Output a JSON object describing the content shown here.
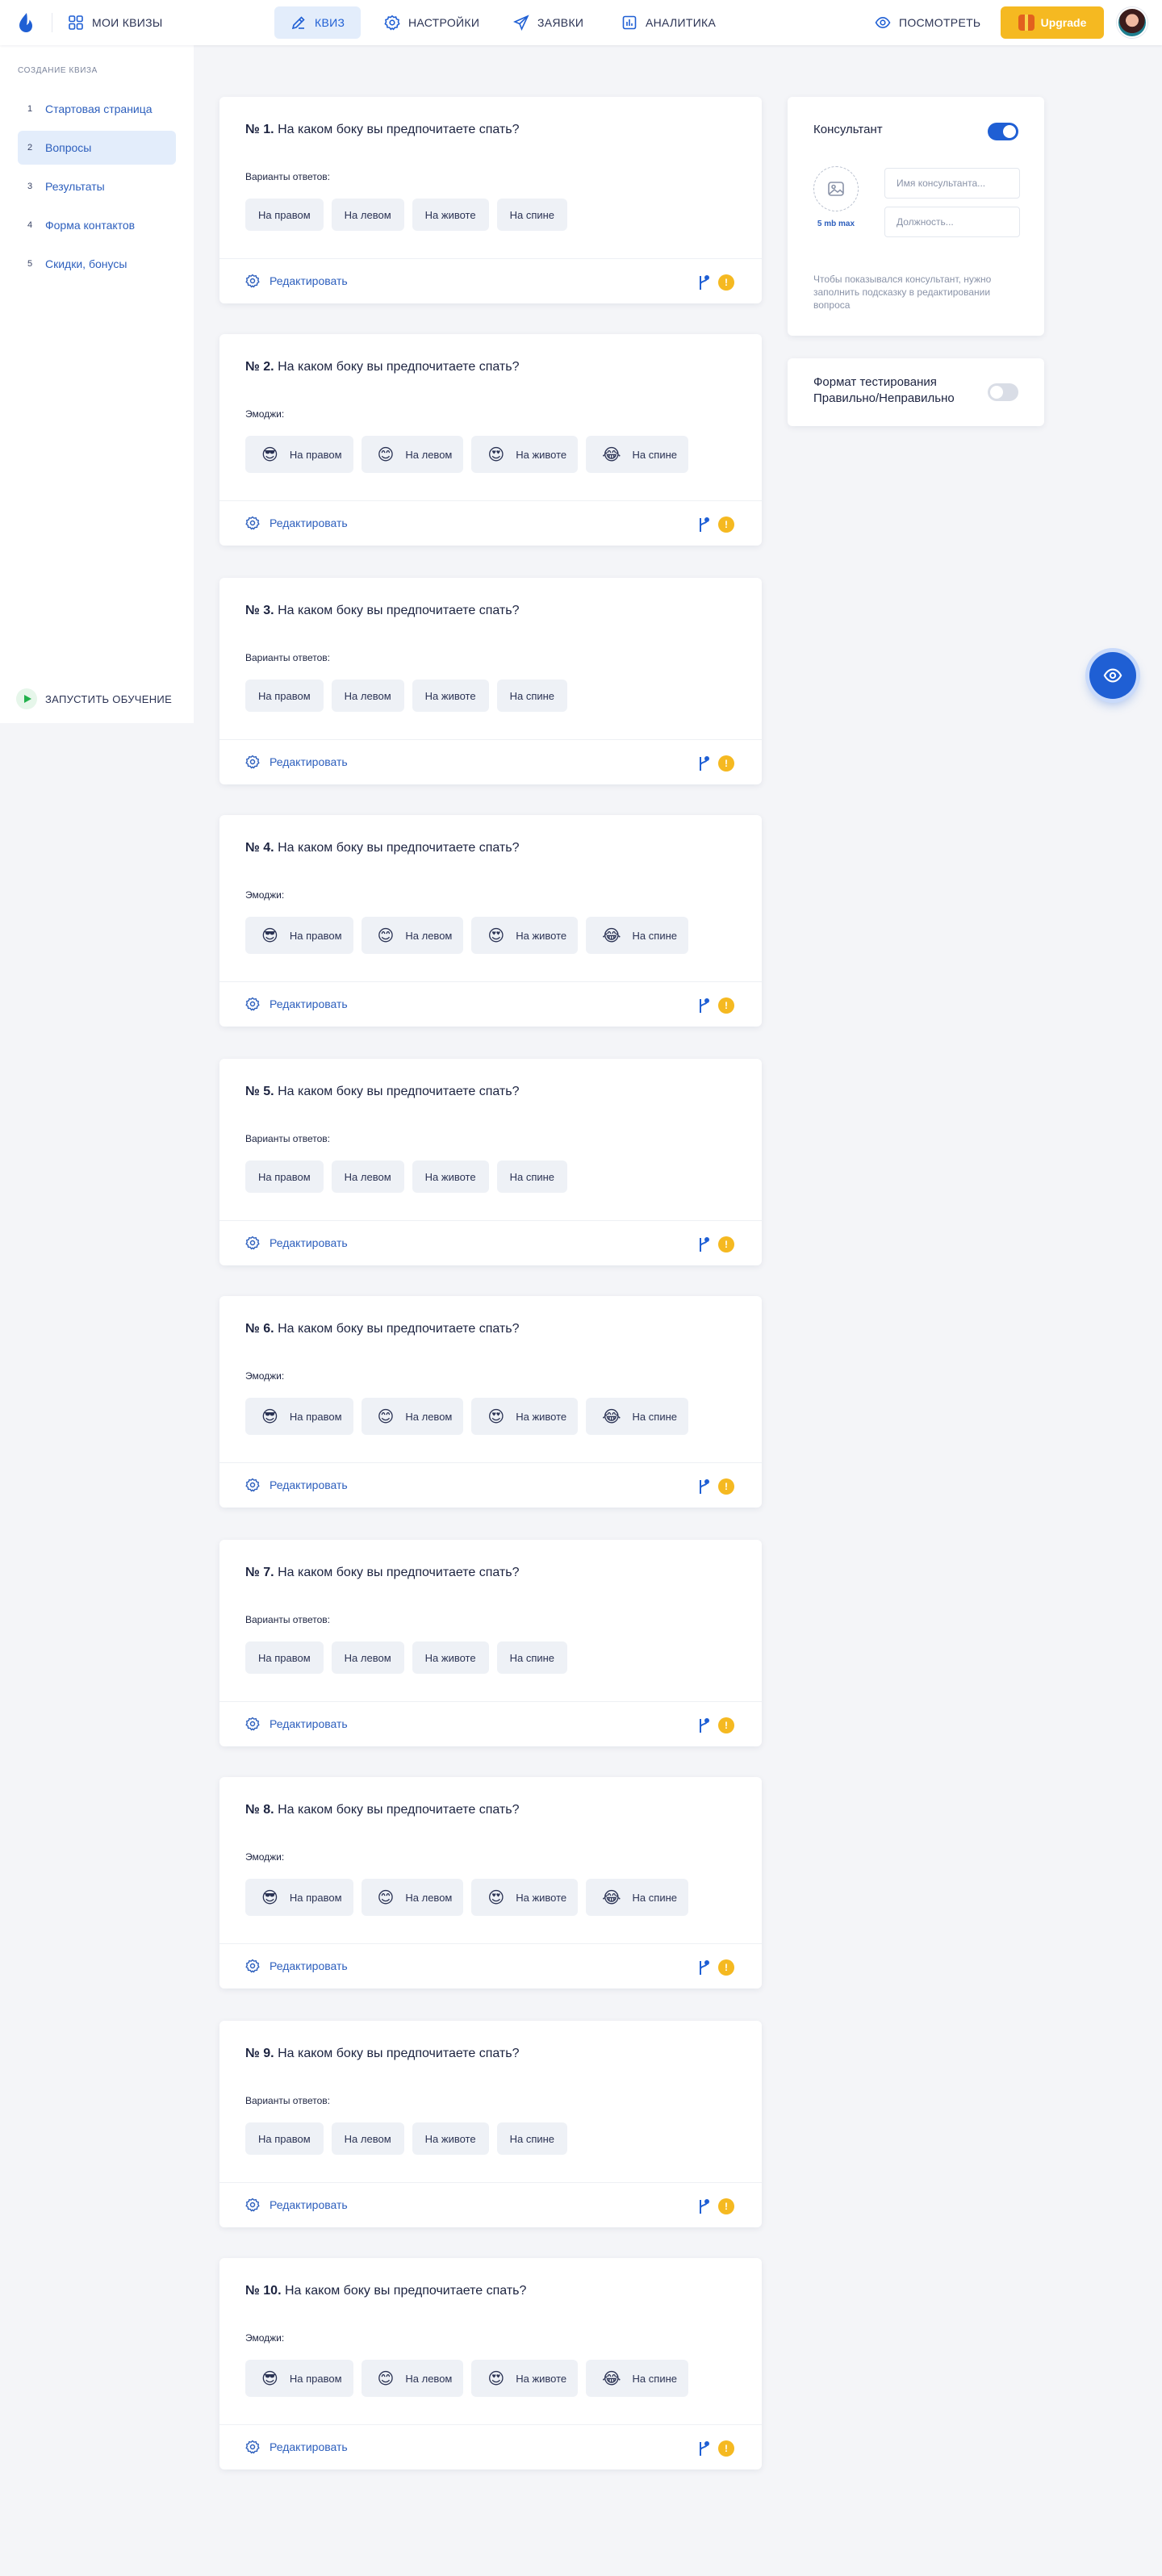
{
  "header": {
    "my_quizzes": "МОИ КВИЗЫ",
    "tabs": [
      {
        "label": "КВИЗ",
        "icon": "pencil-icon"
      },
      {
        "label": "НАСТРОЙКИ",
        "icon": "gear-icon"
      },
      {
        "label": "ЗАЯВКИ",
        "icon": "paper-plane-icon"
      },
      {
        "label": "АНАЛИТИКА",
        "icon": "chart-icon"
      }
    ],
    "preview": "ПОСМОТРЕТЬ",
    "upgrade": "Upgrade"
  },
  "sidebar": {
    "title": "СОЗДАНИЕ КВИЗА",
    "items": [
      {
        "num": "1",
        "label": "Стартовая страница"
      },
      {
        "num": "2",
        "label": "Вопросы"
      },
      {
        "num": "3",
        "label": "Результаты"
      },
      {
        "num": "4",
        "label": "Форма контактов"
      },
      {
        "num": "5",
        "label": "Скидки, бонусы"
      }
    ],
    "learn": "ЗАПУСТИТЬ ОБУЧЕНИЕ"
  },
  "questions": [
    {
      "num": "№ 1.",
      "text": "На каком боку вы предпочитаете спать?",
      "sub": "Варианты ответов:",
      "answers": [
        "На правом",
        "На левом",
        "На животе",
        "На спине"
      ],
      "edit": "Редактировать",
      "badge": "!"
    },
    {
      "num": "№ 2.",
      "text": "На каком боку вы предпочитаете спать?",
      "sub": "Эмоджи:",
      "answers": [
        "На правом",
        "На левом",
        "На животе",
        "На спине"
      ],
      "emojis": [
        "😎",
        "😊",
        "😍",
        "😂"
      ],
      "edit": "Редактировать",
      "badge": "!"
    },
    {
      "num": "№ 3.",
      "text": "На каком боку вы предпочитаете спать?",
      "sub": "Варианты ответов:",
      "answers": [
        "На правом",
        "На левом",
        "На животе",
        "На спине"
      ],
      "edit": "Редактировать",
      "badge": "!"
    },
    {
      "num": "№ 4.",
      "text": "На каком боку вы предпочитаете спать?",
      "sub": "Эмоджи:",
      "answers": [
        "На правом",
        "На левом",
        "На животе",
        "На спине"
      ],
      "emojis": [
        "😎",
        "😊",
        "😍",
        "😂"
      ],
      "edit": "Редактировать",
      "badge": "!"
    },
    {
      "num": "№ 5.",
      "text": "На каком боку вы предпочитаете спать?",
      "sub": "Варианты ответов:",
      "answers": [
        "На правом",
        "На левом",
        "На животе",
        "На спине"
      ],
      "edit": "Редактировать",
      "badge": "!"
    },
    {
      "num": "№ 6.",
      "text": "На каком боку вы предпочитаете спать?",
      "sub": "Эмоджи:",
      "answers": [
        "На правом",
        "На левом",
        "На животе",
        "На спине"
      ],
      "emojis": [
        "😎",
        "😊",
        "😍",
        "😂"
      ],
      "edit": "Редактировать",
      "badge": "!"
    },
    {
      "num": "№ 7.",
      "text": "На каком боку вы предпочитаете спать?",
      "sub": "Варианты ответов:",
      "answers": [
        "На правом",
        "На левом",
        "На животе",
        "На спине"
      ],
      "edit": "Редактировать",
      "badge": "!"
    },
    {
      "num": "№ 8.",
      "text": "На каком боку вы предпочитаете спать?",
      "sub": "Эмоджи:",
      "answers": [
        "На правом",
        "На левом",
        "На животе",
        "На спине"
      ],
      "emojis": [
        "😎",
        "😊",
        "😍",
        "😂"
      ],
      "edit": "Редактировать",
      "badge": "!"
    },
    {
      "num": "№ 9.",
      "text": "На каком боку вы предпочитаете спать?",
      "sub": "Варианты ответов:",
      "answers": [
        "На правом",
        "На левом",
        "На животе",
        "На спине"
      ],
      "edit": "Редактировать",
      "badge": "!"
    },
    {
      "num": "№ 10.",
      "text": "На каком боку вы предпочитаете спать?",
      "sub": "Эмоджи:",
      "answers": [
        "На правом",
        "На левом",
        "На животе",
        "На спине"
      ],
      "emojis": [
        "😎",
        "😊",
        "😍",
        "😂"
      ],
      "edit": "Редактировать",
      "badge": "!"
    }
  ],
  "consultant": {
    "title": "Консультант",
    "enabled": true,
    "photo_limit": "5 mb max",
    "name_placeholder": "Имя консультанта...",
    "position_placeholder": "Должность...",
    "hint": "Чтобы показывался консультант, нужно заполнить подсказку в редактировании вопроса"
  },
  "test_format": {
    "title": "Формат тестирования Правильно/Неправильно",
    "enabled": false
  },
  "colors": {
    "accent": "#1f5fd4",
    "upgrade": "#f5b921",
    "background": "#f4f5f8"
  }
}
